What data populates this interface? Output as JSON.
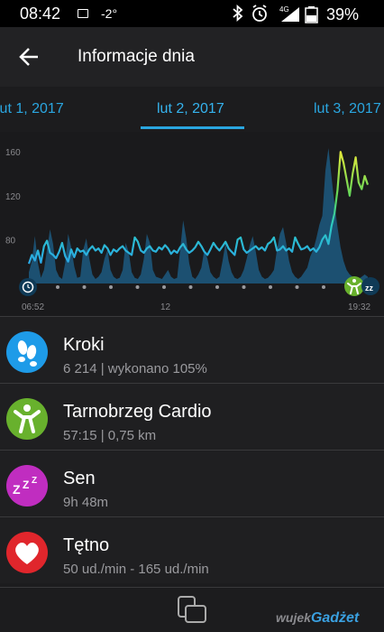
{
  "status_bar": {
    "time": "08:42",
    "temperature": "-2°",
    "network": "4G",
    "battery": "39%"
  },
  "app_bar": {
    "title": "Informacje dnia"
  },
  "date_tabs": {
    "previous": "lut 1, 2017",
    "current": "lut 2, 2017",
    "next": "lut 3, 2017"
  },
  "chart_data": {
    "type": "area",
    "y_ticks": [
      "160",
      "120",
      "80"
    ],
    "ylim": [
      40,
      170
    ],
    "x_labels": [
      "06:52",
      "12",
      "19:32"
    ],
    "series": [
      {
        "kind": "heart-rate",
        "values": [
          58,
          66,
          61,
          70,
          59,
          74,
          79,
          68,
          66,
          63,
          69,
          77,
          65,
          60,
          71,
          64,
          72,
          69,
          70,
          66,
          71,
          74,
          70,
          72,
          68,
          75,
          72,
          66,
          71,
          69,
          72,
          74,
          70,
          68,
          66,
          82,
          78,
          70,
          68,
          72,
          74,
          70,
          69,
          73,
          71,
          75,
          72,
          67,
          70,
          68,
          73,
          76,
          71,
          68,
          70,
          73,
          78,
          74,
          69,
          66,
          71,
          77,
          73,
          70,
          74,
          78,
          72,
          69,
          66,
          80,
          82,
          71,
          68,
          70,
          72,
          74,
          71,
          73,
          70,
          76,
          78,
          82,
          70,
          71,
          74,
          70,
          72,
          69,
          82,
          76,
          71,
          72,
          74,
          70,
          72,
          69,
          73,
          80,
          84,
          76,
          92,
          104,
          125,
          160,
          150,
          135,
          120,
          140,
          155,
          132,
          126,
          138,
          130
        ]
      },
      {
        "kind": "activity",
        "values": [
          10,
          20,
          42,
          18,
          5,
          12,
          30,
          48,
          35,
          12,
          6,
          4,
          18,
          44,
          32,
          15,
          5,
          6,
          30,
          40,
          22,
          8,
          4,
          6,
          10,
          22,
          30,
          12,
          6,
          4,
          5,
          12,
          36,
          28,
          10,
          5,
          4,
          8,
          22,
          44,
          36,
          12,
          6,
          5,
          4,
          8,
          12,
          6,
          4,
          5,
          30,
          56,
          40,
          18,
          6,
          4,
          8,
          14,
          30,
          22,
          10,
          6,
          4,
          6,
          20,
          36,
          20,
          10,
          5,
          4,
          6,
          12,
          22,
          34,
          42,
          28,
          12,
          6,
          4,
          5,
          8,
          12,
          30,
          44,
          50,
          36,
          20,
          10,
          6,
          4,
          6,
          10,
          14,
          24,
          30,
          40,
          52,
          60,
          100,
          120,
          95,
          70,
          50,
          32,
          20,
          12,
          8,
          6,
          5,
          4,
          6,
          8,
          6
        ]
      }
    ],
    "markers": [
      "alarm-clock-icon",
      "activity-icon",
      "sleep-icon"
    ]
  },
  "list": {
    "items": [
      {
        "name": "Kroki",
        "detail": "6 214   |   wykonano 105%",
        "icon": "footsteps-icon",
        "color": "#1e9be8"
      },
      {
        "name": "Tarnobrzeg Cardio",
        "detail": "57:15   |   0,75 km",
        "icon": "activity-person-icon",
        "color": "#68b12d"
      },
      {
        "name": "Sen",
        "detail": "9h 48m",
        "icon": "sleep-zzz-icon",
        "color": "#c02dc0"
      },
      {
        "name": "Tętno",
        "detail": "50 ud./min - 165 ud./min",
        "icon": "heart-icon",
        "color": "#e0262c"
      }
    ]
  },
  "watermark": {
    "prefix": "wujek",
    "brand": "Gadżet"
  }
}
